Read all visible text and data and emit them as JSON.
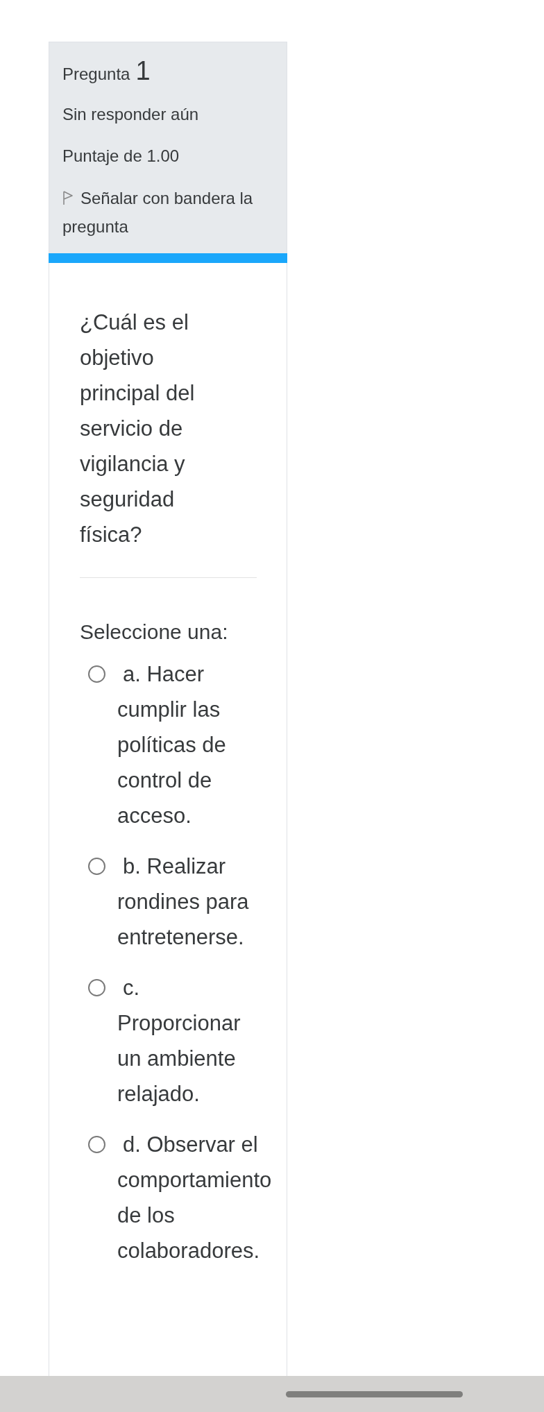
{
  "question_info": {
    "label": "Pregunta",
    "number": "1",
    "status": "Sin responder aún",
    "grade": "Puntaje de 1.00",
    "flag_link": "Señalar con bandera la pregunta",
    "flagged": false
  },
  "question": {
    "text": "¿Cuál es el objetivo principal del servicio de vigilancia y seguridad física?",
    "prompt": "Seleccione una:",
    "options": [
      {
        "text": "a. Hacer cumplir las políticas de control de acceso.",
        "selected": false
      },
      {
        "text": "b. Realizar rondines para entretenerse.",
        "selected": false
      },
      {
        "text": "c. Proporcionar un ambiente relajado.",
        "selected": false
      },
      {
        "text": "d. Observar el comportamiento de los colaboradores.",
        "selected": false
      }
    ]
  }
}
